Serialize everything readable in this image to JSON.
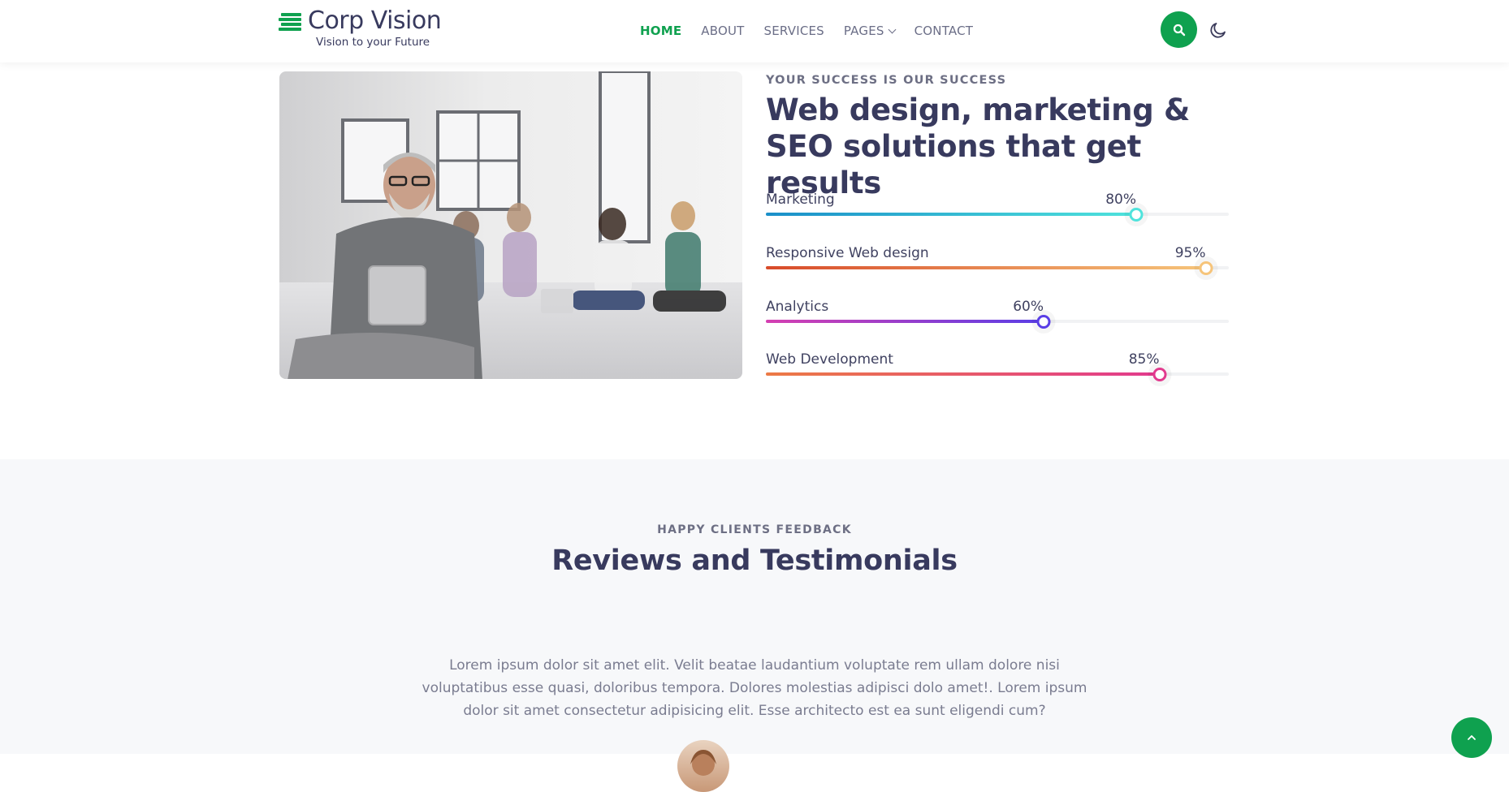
{
  "brand": {
    "name": "Corp Vision",
    "tagline": "Vision to your Future",
    "accent": "#0fa14f",
    "heading_color": "#383a5e"
  },
  "nav": {
    "items": [
      {
        "label": "HOME",
        "active": true
      },
      {
        "label": "ABOUT",
        "active": false
      },
      {
        "label": "SERVICES",
        "active": false
      },
      {
        "label": "PAGES",
        "active": false,
        "has_dropdown": true
      },
      {
        "label": "CONTACT",
        "active": false
      }
    ],
    "search_icon": "search-icon",
    "theme_icon": "moon-icon"
  },
  "hero": {
    "eyebrow": "YOUR SUCCESS IS OUR SUCCESS",
    "title": "Web design, marketing & SEO solutions that get results",
    "skills": [
      {
        "name": "Marketing",
        "percent_label": "80%",
        "value": 80,
        "color_from": "#1a8fc9",
        "color_to": "#4fe3dc"
      },
      {
        "name": "Responsive Web design",
        "percent_label": "95%",
        "value": 95,
        "color_from": "#d84b2a",
        "color_to": "#f6c47a"
      },
      {
        "name": "Analytics",
        "percent_label": "60%",
        "value": 60,
        "color_from": "#d53fb1",
        "color_to": "#5a3ee6"
      },
      {
        "name": "Web Development",
        "percent_label": "85%",
        "value": 85,
        "color_from": "#ec7a45",
        "color_to": "#e23a8e"
      }
    ]
  },
  "testimonials": {
    "eyebrow": "HAPPY CLIENTS FEEDBACK",
    "title": "Reviews and Testimonials",
    "quote": "Lorem ipsum dolor sit amet elit. Velit beatae laudantium voluptate rem ullam dolore nisi voluptatibus esse quasi, doloribus tempora. Dolores molestias adipisci dolo amet!. Lorem ipsum dolor sit amet consectetur adipisicing elit. Esse architecto est ea sunt eligendi cum?"
  },
  "back_to_top_icon": "chevron-up-icon"
}
